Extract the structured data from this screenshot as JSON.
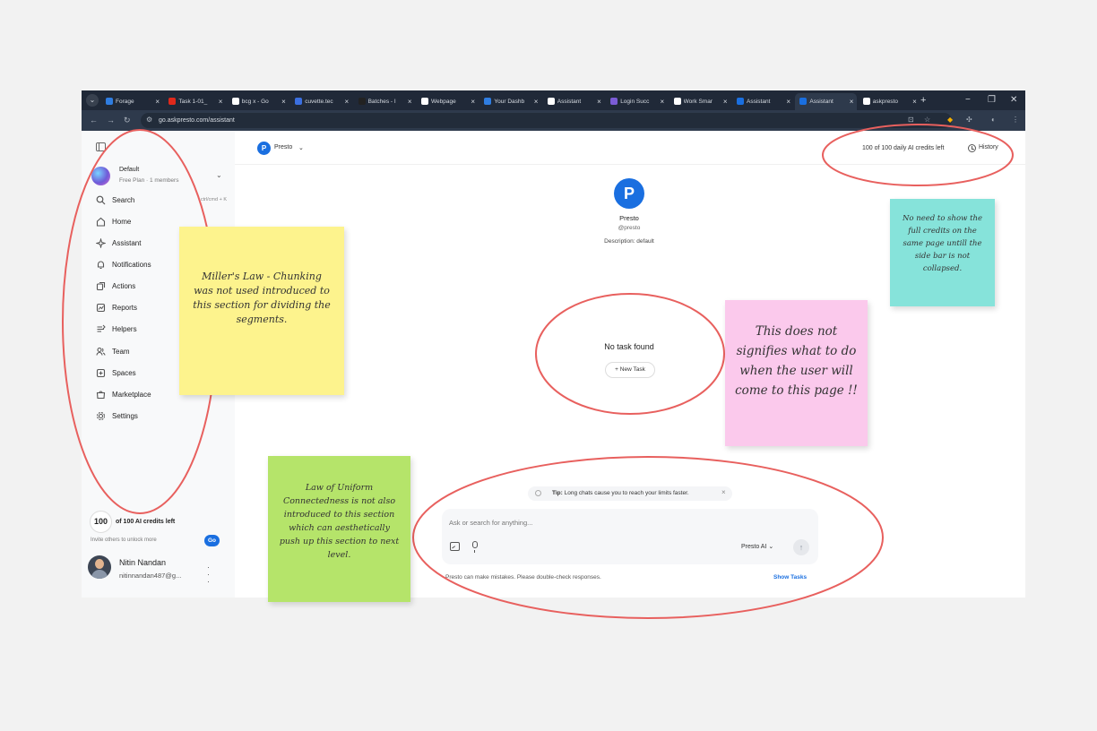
{
  "browser": {
    "tabs": [
      {
        "title": "Forage",
        "color": "#2f7de1"
      },
      {
        "title": "Task 1-01_",
        "color": "#e0291b"
      },
      {
        "title": "bcg x - Go",
        "color": "#ffffff"
      },
      {
        "title": "cuvette.tec",
        "color": "#3b6fe0"
      },
      {
        "title": "Batches - I",
        "color": "#222222"
      },
      {
        "title": "Webpage",
        "color": "#ffffff"
      },
      {
        "title": "Your Dashb",
        "color": "#2f7de1"
      },
      {
        "title": "Assistant",
        "color": "#ffffff"
      },
      {
        "title": "Login Succ",
        "color": "#7b5cd6"
      },
      {
        "title": "Work Smar",
        "color": "#ffffff"
      },
      {
        "title": "Assistant",
        "color": "#1a6fe0"
      },
      {
        "title": "Assistant",
        "color": "#1a6fe0"
      },
      {
        "title": "askpresto",
        "color": "#ffffff"
      }
    ],
    "active_tab_index": 11,
    "url": "go.askpresto.com/assistant",
    "new_tab": "+",
    "window_controls": {
      "minimize": "−",
      "restore": "❐",
      "close": "✕"
    }
  },
  "sidebar": {
    "workspace_name": "Default",
    "workspace_plan": "Free Plan · 1 members",
    "nav": [
      {
        "label": "Search",
        "icon": "search-icon",
        "shortcut": "ctrl/cmd + K"
      },
      {
        "label": "Home",
        "icon": "home-icon"
      },
      {
        "label": "Assistant",
        "icon": "sparkle-icon"
      },
      {
        "label": "Notifications",
        "icon": "bell-icon"
      },
      {
        "label": "Actions",
        "icon": "actions-icon"
      },
      {
        "label": "Reports",
        "icon": "chart-icon"
      },
      {
        "label": "Helpers",
        "icon": "helpers-icon"
      },
      {
        "label": "Team",
        "icon": "team-icon"
      },
      {
        "label": "Spaces",
        "icon": "spaces-icon"
      },
      {
        "label": "Marketplace",
        "icon": "store-icon"
      },
      {
        "label": "Settings",
        "icon": "gear-icon"
      }
    ],
    "credits_number": "100",
    "credits_label": "of 100 AI credits left",
    "invite_text": "Invite others to unlock more",
    "go_label": "Go",
    "user_name": "Nitin Nandan",
    "user_email": "nitinnandan487@g..."
  },
  "main": {
    "agent_selector": "Presto",
    "credits_top": "100 of 100 daily AI credits left",
    "history_label": "History",
    "agent_title": "Presto",
    "agent_handle": "@presto",
    "agent_description": "Description: default",
    "empty_title": "No task found",
    "new_task_label": "+ New Task",
    "tip_bold": "Tip:",
    "tip_text": " Long chats cause you to reach your limits faster.",
    "composer_placeholder": "Ask or search for anything...",
    "model_label": "Presto AI",
    "disclaimer": "Presto can make mistakes. Please double-check responses.",
    "show_tasks_label": "Show Tasks"
  },
  "annotations": {
    "yellow_note": "Miller's Law - Chunking was not used introduced to this section for dividing the segments.",
    "teal_note": "No need to show the full credits on the same page untill the side bar is not collapsed.",
    "pink_note": "This does not signifies what to do when the user will come to this page !!",
    "green_note": "Law of Uniform Connectedness is not also introduced to this section which can aesthetically push up this section to next level.",
    "circle_color": "#e8605e",
    "yellow_color": "#fdf38d",
    "teal_color": "#86e3da",
    "pink_color": "#fbc9ec",
    "green_color": "#b5e46a"
  }
}
